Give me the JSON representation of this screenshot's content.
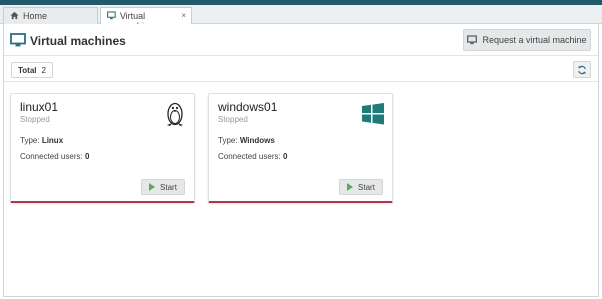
{
  "tabs": [
    {
      "label": "Home",
      "icon": "home-icon"
    },
    {
      "label": "Virtual machines",
      "icon": "monitor-icon",
      "close": "×"
    }
  ],
  "header": {
    "title": "Virtual machines",
    "request_button": "Request a virtual machine"
  },
  "toolbar": {
    "total_label": "Total",
    "total_count": "2"
  },
  "vms": [
    {
      "name": "linux01",
      "state": "Stopped",
      "type_label": "Type:",
      "type_value": "Linux",
      "users_label": "Connected users:",
      "users_value": "0",
      "start_label": "Start",
      "icon": "linux-tux-icon"
    },
    {
      "name": "windows01",
      "state": "Stopped",
      "type_label": "Type:",
      "type_value": "Windows",
      "users_label": "Connected users:",
      "users_value": "0",
      "start_label": "Start",
      "icon": "windows-logo-icon"
    }
  ],
  "colors": {
    "topbar": "#235a6b",
    "card_accent": "#a8384a",
    "windows_logo": "#1f7a7a",
    "play": "#5aa866"
  }
}
